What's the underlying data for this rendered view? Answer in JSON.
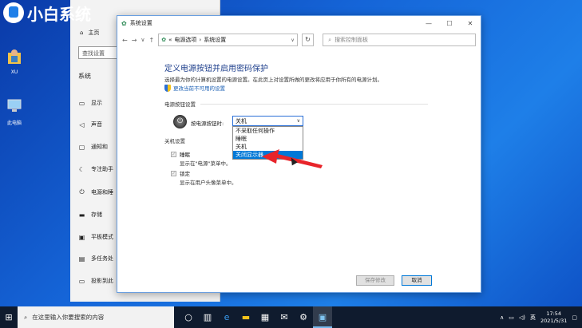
{
  "watermark": {
    "text": "小白系统"
  },
  "desktop": {
    "icons": [
      {
        "label": "XU",
        "icon": "user-folder-icon"
      },
      {
        "label": "此电脑",
        "icon": "computer-icon"
      }
    ]
  },
  "settings": {
    "home": "主页",
    "search_placeholder": "查找设置",
    "section": "系统",
    "nav": [
      {
        "label": "显示",
        "icon": "▭"
      },
      {
        "label": "声音",
        "icon": "◁"
      },
      {
        "label": "通知和",
        "icon": "▢"
      },
      {
        "label": "专注助手",
        "icon": "☾"
      },
      {
        "label": "电源和睡",
        "icon": "⏻"
      },
      {
        "label": "存储",
        "icon": "▬"
      },
      {
        "label": "平板模式",
        "icon": "▣"
      },
      {
        "label": "多任务处",
        "icon": "▤"
      },
      {
        "label": "投影到此",
        "icon": "▭"
      }
    ]
  },
  "dialog": {
    "title": "系统设置",
    "breadcrumb": {
      "prefix": "«",
      "items": [
        "电源选项",
        "系统设置"
      ]
    },
    "search_placeholder": "搜索控制面板",
    "heading": "定义电源按钮并启用密码保护",
    "description": "选择最为你的计算机设置的电源设置。在此页上对设置所做的更改将应用于你所有的电源计划。",
    "admin_link": "更改当前不可用的设置",
    "power_button_section": "电源按钮设置",
    "power_button_label": "按电源按钮时:",
    "selected_value": "关机",
    "options": [
      "不采取任何操作",
      "睡眠",
      "关机",
      "关闭显示器"
    ],
    "shutdown_section": "关机设置",
    "sleep_checkbox": {
      "label": "睡眠",
      "desc": "显示在\"电源\"菜单中。"
    },
    "lock_checkbox": {
      "label": "锁定",
      "desc": "显示在用户头像菜单中。"
    },
    "save_button": "保存修改",
    "cancel_button": "取消"
  },
  "taskbar": {
    "search_placeholder": "在这里输入你要搜索的内容",
    "tray_lang": "英",
    "time": "17:54",
    "date": "2021/5/31"
  },
  "colors": {
    "accent": "#0078d7",
    "annotation_arrow": "#e8242a",
    "heading": "#1e3f8c"
  }
}
